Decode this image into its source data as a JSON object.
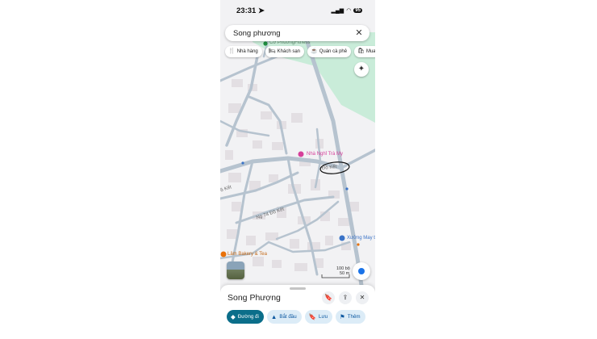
{
  "status": {
    "time": "23:31",
    "battery": "95"
  },
  "search": {
    "query": "Song phương"
  },
  "chips": [
    {
      "icon": "fork-knife-icon",
      "label": "Nhà hàng"
    },
    {
      "icon": "bed-icon",
      "label": "Khách sạn"
    },
    {
      "icon": "coffee-cup-icon",
      "label": "Quán cà phê"
    },
    {
      "icon": "shopping-bag-icon",
      "label": "Mua"
    }
  ],
  "map_labels": {
    "gym": "Cơ PhuởngFitness",
    "poi_pink": "Nhà Nghỉ Trà My",
    "road_circled": "Đồ Kết",
    "road_side": "Đồ Kết",
    "road_lane": "Ng 74 Đồ Kết",
    "workshop": "Xưởng May t",
    "bakery": "Lâm Bakery & Tea",
    "scale_ft": "100 bộ",
    "scale_m": "50 m"
  },
  "colors": {
    "map_bg": "#f2f2f4",
    "park": "#c9ecd9",
    "road": "#b6c3cf",
    "building": "#e3dfe3",
    "primary_action": "#0b6e8a",
    "poi_pink": "#d63f9a",
    "poi_blue": "#3a73c7"
  },
  "sheet": {
    "title": "Song Phượng",
    "actions": [
      {
        "icon": "directions-icon",
        "label": "Đường đi",
        "primary": true
      },
      {
        "icon": "navigation-arrow-icon",
        "label": "Bắt đầu"
      },
      {
        "icon": "bookmark-icon",
        "label": "Lưu"
      },
      {
        "icon": "flag-icon",
        "label": "Thêm"
      }
    ]
  }
}
